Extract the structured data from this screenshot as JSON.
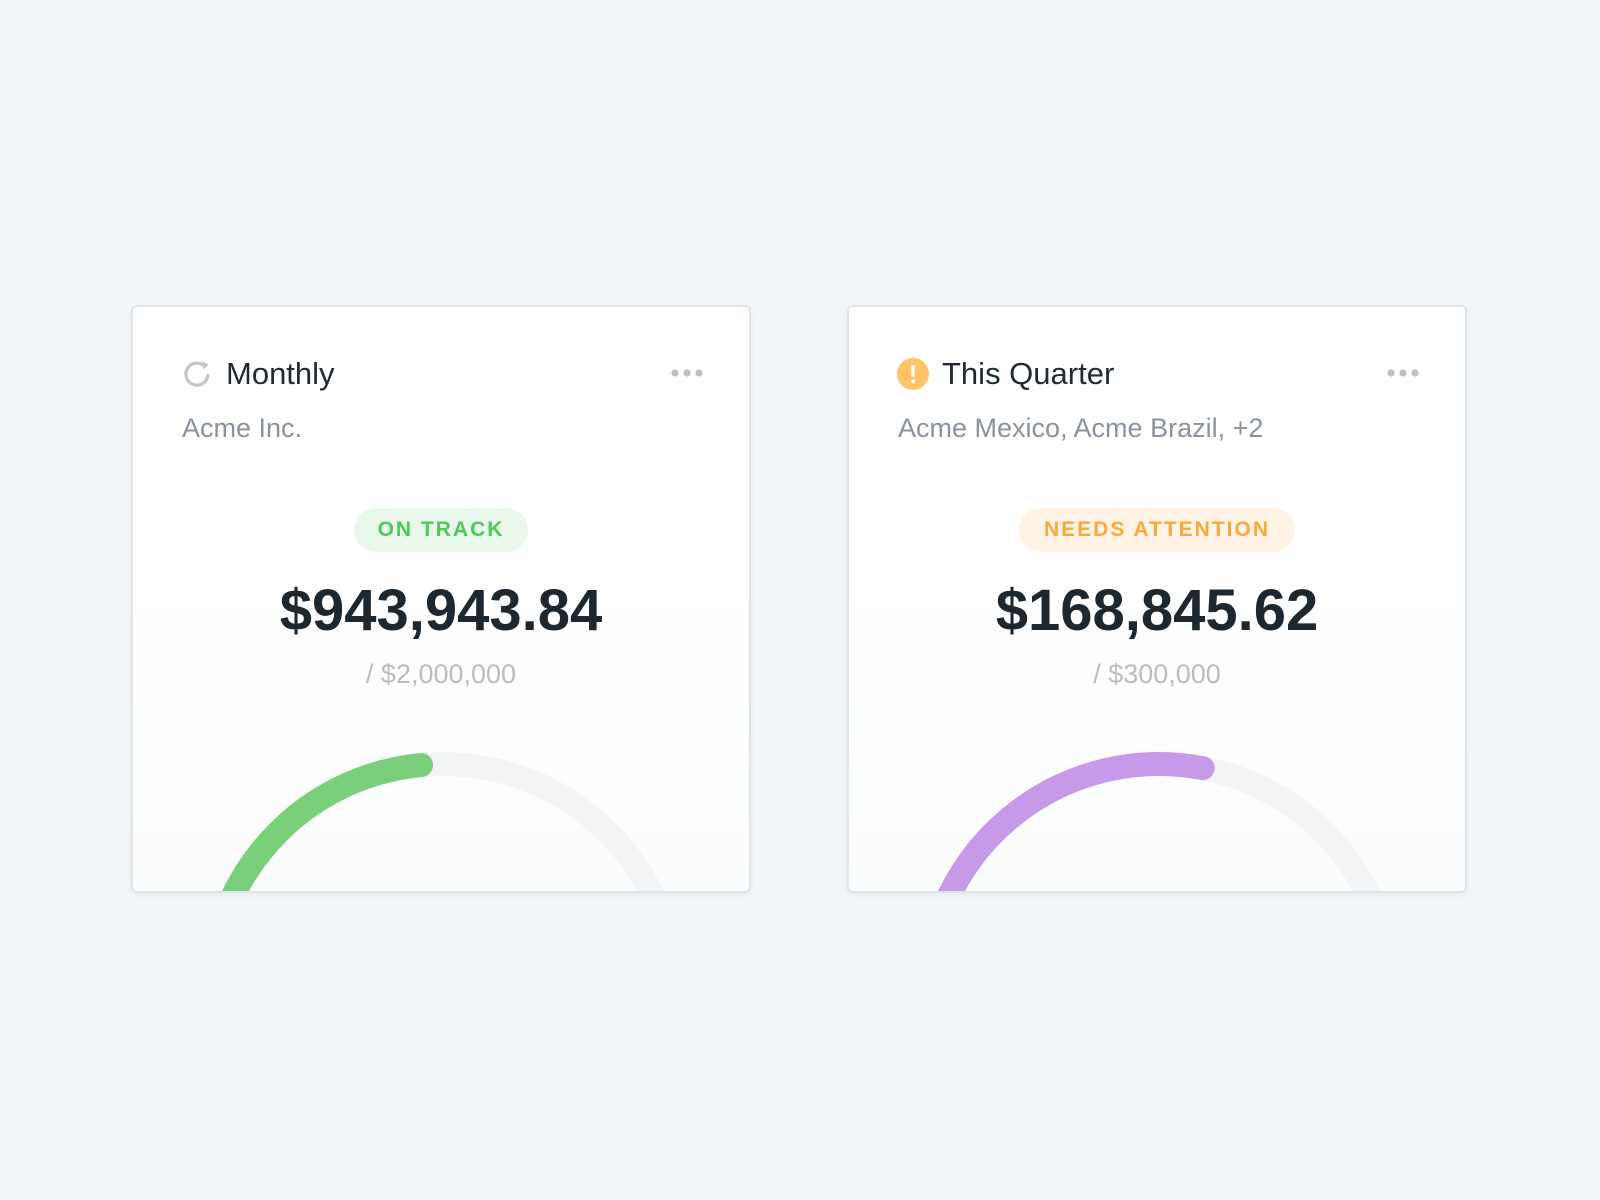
{
  "cards": [
    {
      "title": "Monthly",
      "subtitle": "Acme Inc.",
      "icon": "refresh-icon",
      "status": "ON TRACK",
      "status_color": "#4fc85a",
      "amount": "$943,943.84",
      "target": "/ $2,000,000",
      "progress_fraction": 0.47,
      "arc_color": "#7ad07a",
      "more_icon": "more-horizontal-icon"
    },
    {
      "title": "This Quarter",
      "subtitle": "Acme Mexico, Acme Brazil, +2",
      "icon": "alert-circle-icon",
      "icon_color": "#ffc467",
      "status": "NEEDS ATTENTION",
      "status_color": "#f7a93c",
      "amount": "$168,845.62",
      "target": "/ $300,000",
      "progress_fraction": 0.56,
      "arc_color": "#c799e9",
      "more_icon": "more-horizontal-icon"
    }
  ],
  "track_color": "#f3f4f6"
}
